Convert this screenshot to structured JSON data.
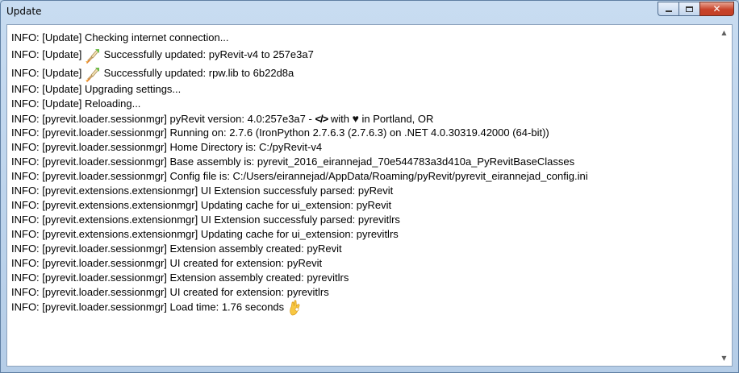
{
  "window": {
    "title": "Update",
    "controls": {
      "close_glyph": "✕"
    }
  },
  "log": {
    "lines": [
      "INFO: [Update] Checking internet connection...",
      {
        "before": "INFO: [Update] ",
        "icon": "rocket-icon",
        "after": " Successfully updated: pyRevit-v4 to 257e3a7"
      },
      {
        "before": "INFO: [Update] ",
        "icon": "rocket-icon",
        "after": " Successfully updated: rpw.lib to 6b22d8a"
      },
      "INFO: [Update] Upgrading settings...",
      "INFO: [Update] Reloading...",
      {
        "before": "INFO: [pyrevit.loader.sessionmgr] pyRevit version: 4.0:257e3a7 - ",
        "code": "</>",
        "mid": " with ",
        "heart": "♥",
        "after": " in Portland, OR"
      },
      "INFO: [pyrevit.loader.sessionmgr] Running on: 2.7.6 (IronPython 2.7.6.3 (2.7.6.3) on .NET 4.0.30319.42000 (64-bit))",
      "INFO: [pyrevit.loader.sessionmgr] Home Directory is: C:/pyRevit-v4",
      "INFO: [pyrevit.loader.sessionmgr] Base assembly is: pyrevit_2016_eirannejad_70e544783a3d410a_PyRevitBaseClasses",
      "INFO: [pyrevit.loader.sessionmgr] Config file is: C:/Users/eirannejad/AppData/Roaming/pyRevit/pyrevit_eirannejad_config.ini",
      "INFO: [pyrevit.extensions.extensionmgr] UI Extension successfuly parsed: pyRevit",
      "INFO: [pyrevit.extensions.extensionmgr] Updating cache for ui_extension: pyRevit",
      "INFO: [pyrevit.extensions.extensionmgr] UI Extension successfuly parsed: pyrevitlrs",
      "INFO: [pyrevit.extensions.extensionmgr] Updating cache for ui_extension: pyrevitlrs",
      "INFO: [pyrevit.loader.sessionmgr] Extension assembly created: pyRevit",
      "INFO: [pyrevit.loader.sessionmgr] UI created for extension: pyRevit",
      "INFO: [pyrevit.loader.sessionmgr] Extension assembly created: pyrevitlrs",
      "INFO: [pyrevit.loader.sessionmgr] UI created for extension: pyrevitlrs",
      {
        "before": "INFO: [pyrevit.loader.sessionmgr] Load time: 1.76 seconds ",
        "icon": "ok-hand-icon",
        "after": ""
      }
    ]
  },
  "scrollbar": {
    "up_glyph": "▲",
    "down_glyph": "▼"
  },
  "colors": {
    "accent_close": "#c8432a",
    "frame": "#bcd3e9"
  }
}
